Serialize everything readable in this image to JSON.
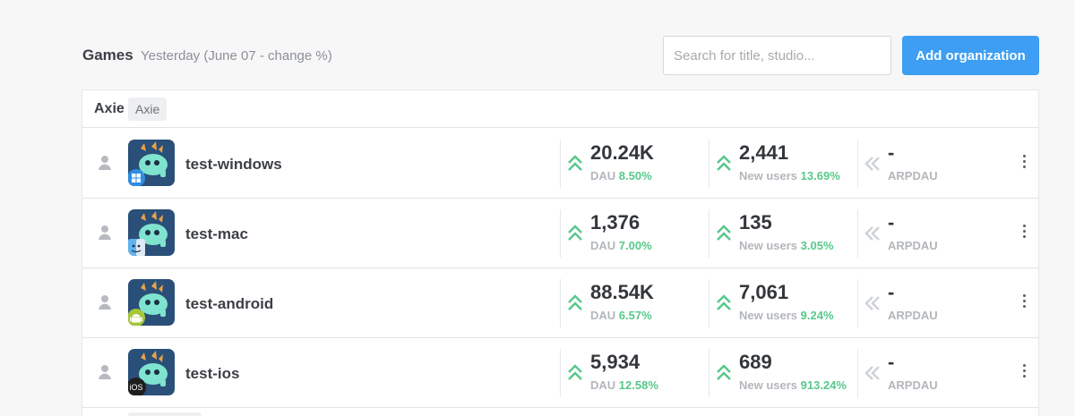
{
  "header": {
    "title": "Games",
    "subtitle": "Yesterday (June 07 - change %)",
    "search_placeholder": "Search for title, studio...",
    "add_button_label": "Add organization",
    "accent_color": "#3d9ef3"
  },
  "organization": {
    "name": "Axie",
    "tag": "Axie"
  },
  "metric_colors": {
    "up": "#58c889",
    "neutral": "#cfd2d6"
  },
  "games": [
    {
      "name": "test-windows",
      "platform": "windows-icon",
      "dau": {
        "value": "20.24K",
        "label": "DAU",
        "change": "8.50%",
        "trend": "up"
      },
      "new_users": {
        "value": "2,441",
        "label": "New users",
        "change": "13.69%",
        "trend": "up"
      },
      "arpdau": {
        "value": "-",
        "label": "ARPDAU",
        "change": "",
        "trend": "neutral"
      }
    },
    {
      "name": "test-mac",
      "platform": "mac-finder-icon",
      "dau": {
        "value": "1,376",
        "label": "DAU",
        "change": "7.00%",
        "trend": "up"
      },
      "new_users": {
        "value": "135",
        "label": "New users",
        "change": "3.05%",
        "trend": "up"
      },
      "arpdau": {
        "value": "-",
        "label": "ARPDAU",
        "change": "",
        "trend": "neutral"
      }
    },
    {
      "name": "test-android",
      "platform": "android-icon",
      "dau": {
        "value": "88.54K",
        "label": "DAU",
        "change": "6.57%",
        "trend": "up"
      },
      "new_users": {
        "value": "7,061",
        "label": "New users",
        "change": "9.24%",
        "trend": "up"
      },
      "arpdau": {
        "value": "-",
        "label": "ARPDAU",
        "change": "",
        "trend": "neutral"
      }
    },
    {
      "name": "test-ios",
      "platform": "ios-icon",
      "platform_text": "iOS",
      "dau": {
        "value": "5,934",
        "label": "DAU",
        "change": "12.58%",
        "trend": "up"
      },
      "new_users": {
        "value": "689",
        "label": "New users",
        "change": "913.24%",
        "trend": "up"
      },
      "arpdau": {
        "value": "-",
        "label": "ARPDAU",
        "change": "",
        "trend": "neutral"
      }
    }
  ]
}
